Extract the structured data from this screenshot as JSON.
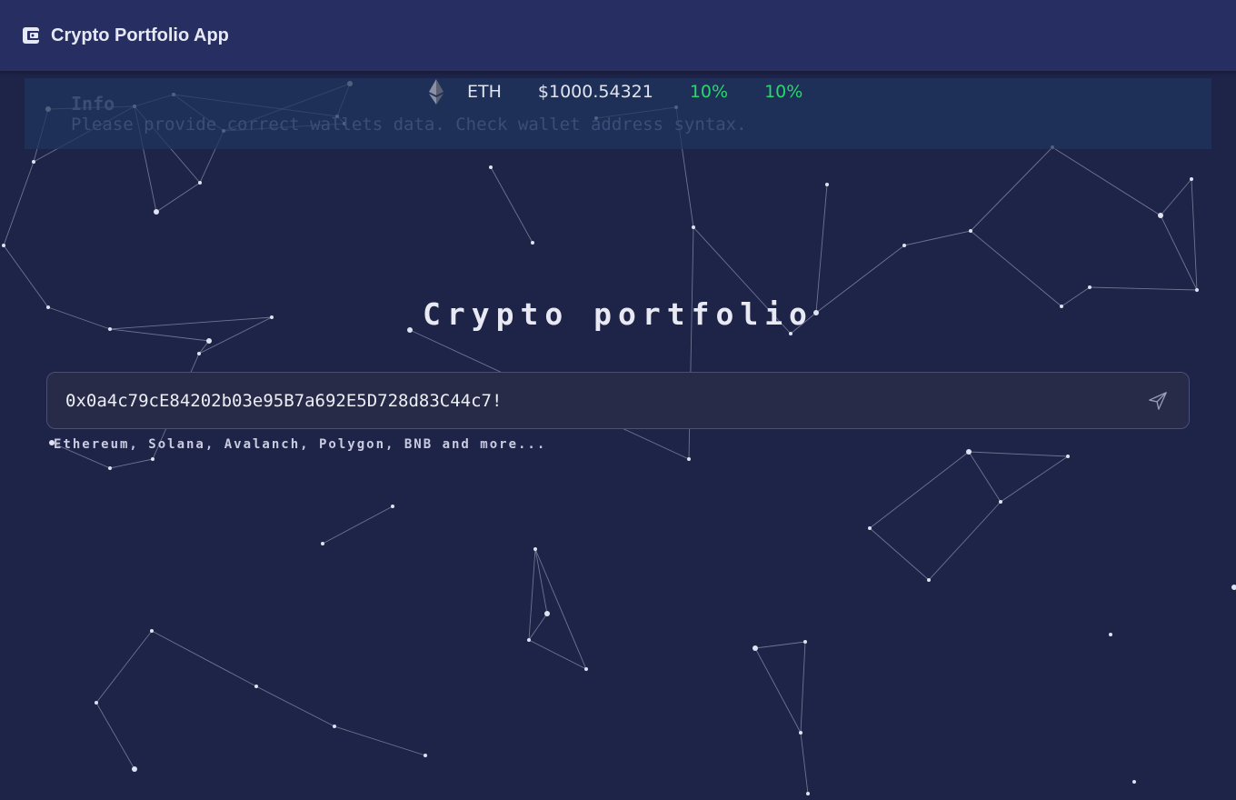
{
  "app": {
    "title": "Crypto Portfolio App",
    "icon": "wallet-icon"
  },
  "info": {
    "title": "Info",
    "message": "Please provide correct wallets data. Check wallet address syntax."
  },
  "ticker": {
    "icon": "ethereum-icon",
    "symbol": "ETH",
    "price": "$1000.54321",
    "change_1": "10%",
    "change_2": "10%"
  },
  "main": {
    "heading": "Crypto portfolio",
    "address_value": "0x0a4c79cE84202b03e95B7a692E5D728d83C44c7!",
    "send_icon": "send-icon",
    "supported_chains": "Ethereum, Solana, Avalanch, Polygon, BNB and more..."
  },
  "colors": {
    "background": "#1e2348",
    "topbar": "#262e62",
    "positive_change": "#27d86e"
  }
}
